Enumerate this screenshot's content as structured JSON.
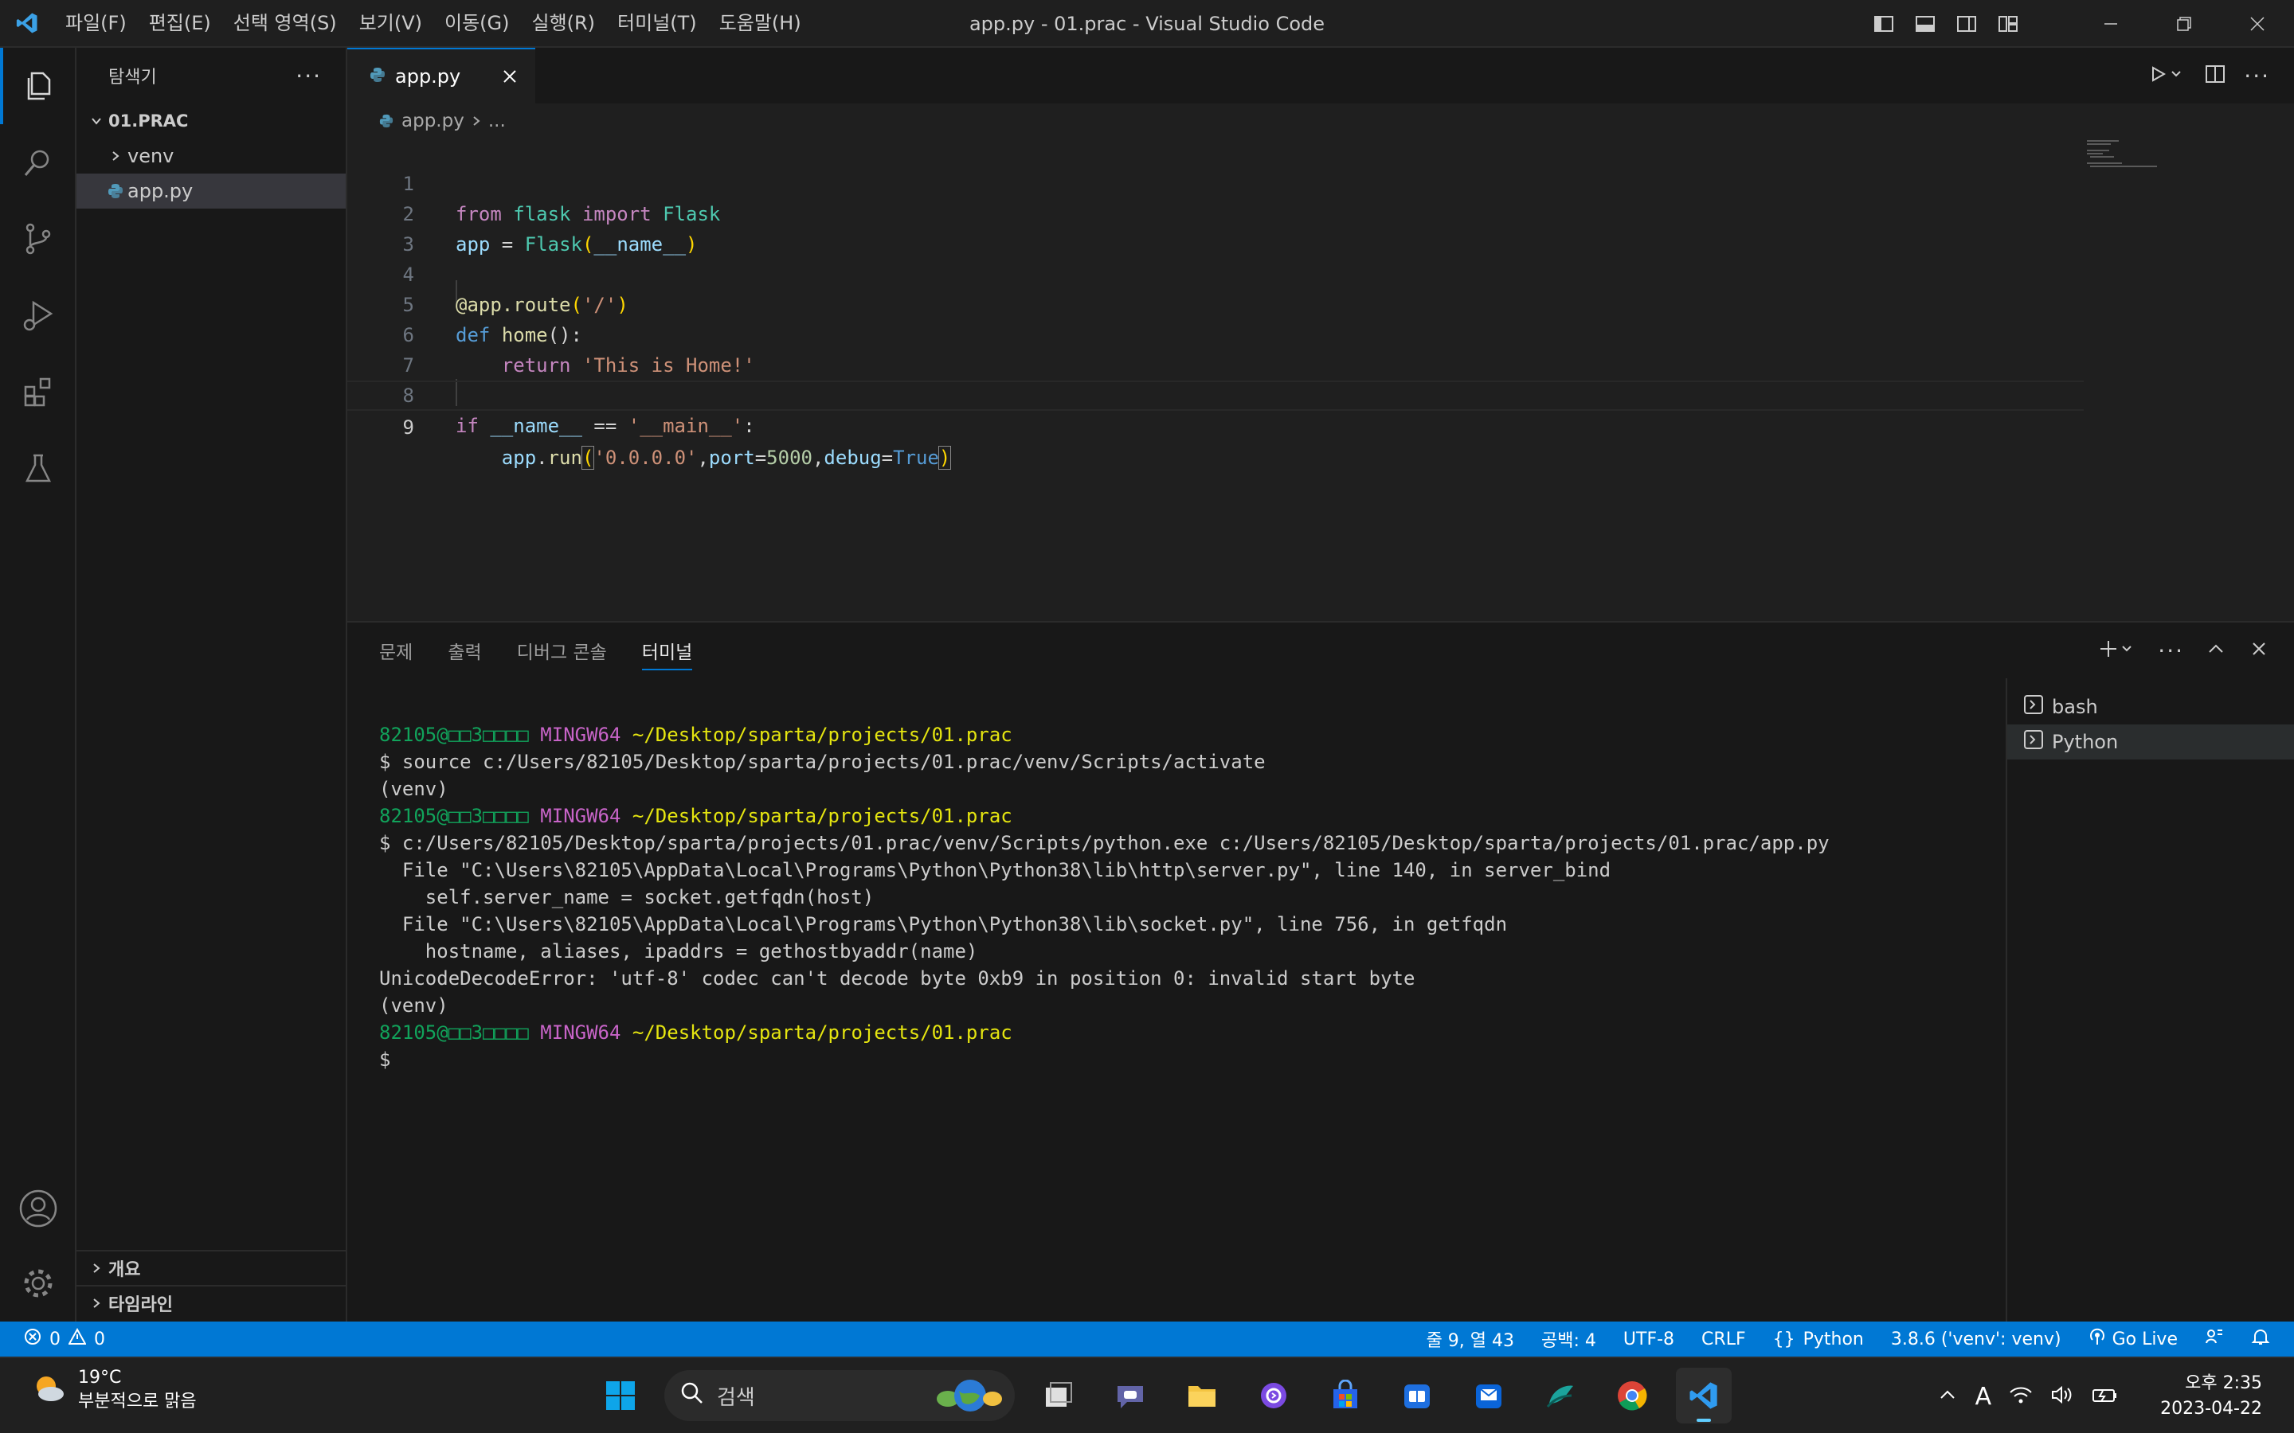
{
  "titlebar": {
    "menu": [
      "파일(F)",
      "편집(E)",
      "선택 영역(S)",
      "보기(V)",
      "이동(G)",
      "실행(R)",
      "터미널(T)",
      "도움말(H)"
    ],
    "title": "app.py - 01.prac - Visual Studio Code"
  },
  "sidebar": {
    "title": "탐색기",
    "folder": "01.PRAC",
    "items": [
      {
        "label": "venv",
        "type": "folder"
      },
      {
        "label": "app.py",
        "type": "file"
      }
    ],
    "outline": "개요",
    "timeline": "타임라인"
  },
  "editor": {
    "tab": "app.py",
    "breadcrumb_file": "app.py",
    "breadcrumb_more": "...",
    "line_numbers": [
      "1",
      "2",
      "3",
      "4",
      "5",
      "6",
      "7",
      "8",
      "9"
    ],
    "code": {
      "l1": {
        "from": "from",
        "mod": "flask",
        "import": "import",
        "cls": "Flask"
      },
      "l2": {
        "var": "app",
        "eq": " = ",
        "cls": "Flask",
        "open": "(",
        "arg": "__name__",
        "close": ")"
      },
      "l4": {
        "dec": "@app.route",
        "open": "(",
        "str": "'/'",
        "close": ")"
      },
      "l5": {
        "def": "def",
        "fn": "home",
        "rest": "():"
      },
      "l6": {
        "ret": "return",
        "str": "'This is Home!'"
      },
      "l8": {
        "if": "if",
        "var": "__name__",
        "op": " == ",
        "str": "'__main__'",
        "colon": ":"
      },
      "l9": {
        "obj": "app",
        "dot": ".",
        "fn": "run",
        "open": "(",
        "str": "'0.0.0.0'",
        "comma1": ",",
        "port": "port",
        "eq1": "=",
        "num": "5000",
        "comma2": ",",
        "debug": "debug",
        "eq2": "=",
        "val": "True",
        "close": ")"
      }
    }
  },
  "panel": {
    "tabs": [
      "문제",
      "출력",
      "디버그 콘솔",
      "터미널"
    ],
    "active_tab": "터미널",
    "terminal": [
      {
        "user": "82105@□□3□□□□",
        "host": "MINGW64",
        "path": "~/Desktop/sparta/projects/01.prac"
      },
      {
        "text": "$ source c:/Users/82105/Desktop/sparta/projects/01.prac/venv/Scripts/activate"
      },
      {
        "text": "(venv)"
      },
      {
        "user": "82105@□□3□□□□",
        "host": "MINGW64",
        "path": "~/Desktop/sparta/projects/01.prac"
      },
      {
        "text": "$ c:/Users/82105/Desktop/sparta/projects/01.prac/venv/Scripts/python.exe c:/Users/82105/Desktop/sparta/projects/01.prac/app.py"
      },
      {
        "text": "  File \"C:\\Users\\82105\\AppData\\Local\\Programs\\Python\\Python38\\lib\\http\\server.py\", line 140, in server_bind"
      },
      {
        "text": "    self.server_name = socket.getfqdn(host)"
      },
      {
        "text": "  File \"C:\\Users\\82105\\AppData\\Local\\Programs\\Python\\Python38\\lib\\socket.py\", line 756, in getfqdn"
      },
      {
        "text": "    hostname, aliases, ipaddrs = gethostbyaddr(name)"
      },
      {
        "text": "UnicodeDecodeError: 'utf-8' codec can't decode byte 0xb9 in position 0: invalid start byte"
      },
      {
        "text": "(venv)"
      },
      {
        "user": "82105@□□3□□□□",
        "host": "MINGW64",
        "path": "~/Desktop/sparta/projects/01.prac"
      },
      {
        "text": "$"
      }
    ],
    "terminals": [
      "bash",
      "Python"
    ]
  },
  "statusbar": {
    "errors": "0",
    "warnings": "0",
    "position": "줄 9, 열 43",
    "spaces": "공백: 4",
    "encoding": "UTF-8",
    "eol": "CRLF",
    "language": "Python",
    "interpreter": "3.8.6 ('venv': venv)",
    "golive": "Go Live"
  },
  "taskbar": {
    "temp": "19°C",
    "weather": "부분적으로 맑음",
    "search": "검색",
    "time": "오후 2:35",
    "date": "2023-04-22"
  },
  "colors": {
    "accent": "#0078d4",
    "statusbar": "#0078d4",
    "editor_bg": "#1f1f1f"
  }
}
